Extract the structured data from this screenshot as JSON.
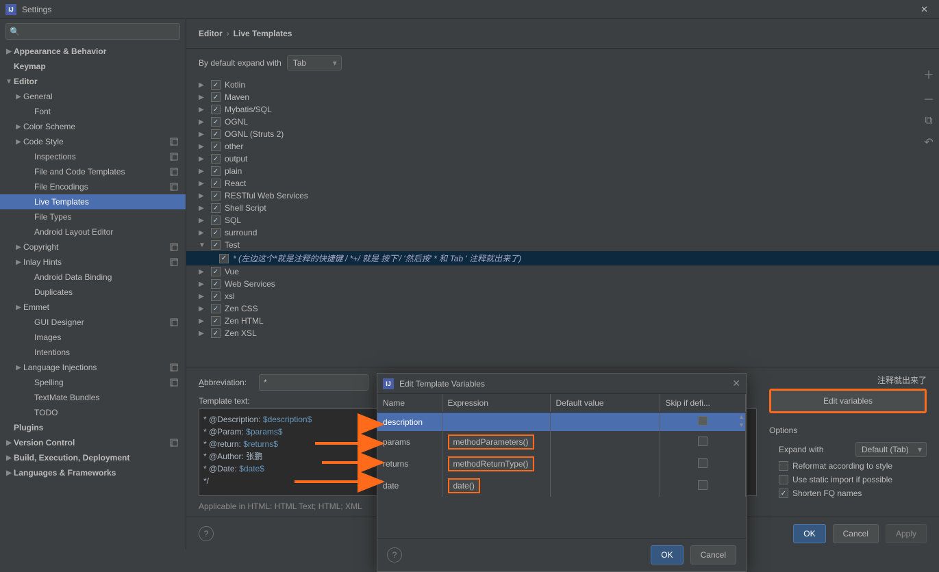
{
  "window": {
    "title": "Settings"
  },
  "search": {
    "placeholder": ""
  },
  "sidebar": {
    "items": [
      {
        "label": "Appearance & Behavior",
        "bold": true,
        "exp": "▶",
        "ind": 0
      },
      {
        "label": "Keymap",
        "bold": true,
        "exp": "",
        "ind": 0
      },
      {
        "label": "Editor",
        "bold": true,
        "exp": "▼",
        "ind": 0
      },
      {
        "label": "General",
        "exp": "▶",
        "ind": 1
      },
      {
        "label": "Font",
        "exp": "",
        "ind": 2
      },
      {
        "label": "Color Scheme",
        "exp": "▶",
        "ind": 1
      },
      {
        "label": "Code Style",
        "exp": "▶",
        "ind": 1,
        "badge": true
      },
      {
        "label": "Inspections",
        "exp": "",
        "ind": 2,
        "badge": true
      },
      {
        "label": "File and Code Templates",
        "exp": "",
        "ind": 2,
        "badge": true
      },
      {
        "label": "File Encodings",
        "exp": "",
        "ind": 2,
        "badge": true
      },
      {
        "label": "Live Templates",
        "exp": "",
        "ind": 2,
        "selected": true
      },
      {
        "label": "File Types",
        "exp": "",
        "ind": 2
      },
      {
        "label": "Android Layout Editor",
        "exp": "",
        "ind": 2
      },
      {
        "label": "Copyright",
        "exp": "▶",
        "ind": 1,
        "badge": true
      },
      {
        "label": "Inlay Hints",
        "exp": "▶",
        "ind": 1,
        "badge": true
      },
      {
        "label": "Android Data Binding",
        "exp": "",
        "ind": 2
      },
      {
        "label": "Duplicates",
        "exp": "",
        "ind": 2
      },
      {
        "label": "Emmet",
        "exp": "▶",
        "ind": 1
      },
      {
        "label": "GUI Designer",
        "exp": "",
        "ind": 2,
        "badge": true
      },
      {
        "label": "Images",
        "exp": "",
        "ind": 2
      },
      {
        "label": "Intentions",
        "exp": "",
        "ind": 2
      },
      {
        "label": "Language Injections",
        "exp": "▶",
        "ind": 1,
        "badge": true
      },
      {
        "label": "Spelling",
        "exp": "",
        "ind": 2,
        "badge": true
      },
      {
        "label": "TextMate Bundles",
        "exp": "",
        "ind": 2
      },
      {
        "label": "TODO",
        "exp": "",
        "ind": 2
      },
      {
        "label": "Plugins",
        "bold": true,
        "exp": "",
        "ind": 0
      },
      {
        "label": "Version Control",
        "bold": true,
        "exp": "▶",
        "ind": 0,
        "badge": true
      },
      {
        "label": "Build, Execution, Deployment",
        "bold": true,
        "exp": "▶",
        "ind": 0
      },
      {
        "label": "Languages & Frameworks",
        "bold": true,
        "exp": "▶",
        "ind": 0
      }
    ]
  },
  "breadcrumb": {
    "a": "Editor",
    "b": "Live Templates"
  },
  "expand": {
    "label": "By default expand with",
    "value": "Tab"
  },
  "templates": [
    {
      "label": "Kotlin",
      "exp": "▶",
      "chk": true
    },
    {
      "label": "Maven",
      "exp": "▶",
      "chk": true
    },
    {
      "label": "Mybatis/SQL",
      "exp": "▶",
      "chk": true
    },
    {
      "label": "OGNL",
      "exp": "▶",
      "chk": true
    },
    {
      "label": "OGNL (Struts 2)",
      "exp": "▶",
      "chk": true
    },
    {
      "label": "other",
      "exp": "▶",
      "chk": true
    },
    {
      "label": "output",
      "exp": "▶",
      "chk": true
    },
    {
      "label": "plain",
      "exp": "▶",
      "chk": true
    },
    {
      "label": "React",
      "exp": "▶",
      "chk": true
    },
    {
      "label": "RESTful Web Services",
      "exp": "▶",
      "chk": true
    },
    {
      "label": "Shell Script",
      "exp": "▶",
      "chk": true
    },
    {
      "label": "SQL",
      "exp": "▶",
      "chk": true
    },
    {
      "label": "surround",
      "exp": "▶",
      "chk": true
    },
    {
      "label": "Test",
      "exp": "▼",
      "chk": true
    },
    {
      "label": "* (左边这个*就是注释的快捷键  /  *+/ 就是 按下'/ '然后按' * 和 Tab ' 注释就出来了)",
      "child": true,
      "chk": true,
      "selected": true,
      "italic": true
    },
    {
      "label": "Vue",
      "exp": "▶",
      "chk": true
    },
    {
      "label": "Web Services",
      "exp": "▶",
      "chk": true
    },
    {
      "label": "xsl",
      "exp": "▶",
      "chk": true
    },
    {
      "label": "Zen CSS",
      "exp": "▶",
      "chk": true
    },
    {
      "label": "Zen HTML",
      "exp": "▶",
      "chk": true
    },
    {
      "label": "Zen XSL",
      "exp": "▶",
      "chk": true
    }
  ],
  "abbrev": {
    "label": "Abbreviation:",
    "value": "*",
    "desc_value": "注释就出来了"
  },
  "tmpltext": {
    "label": "Template text:",
    "lines": [
      {
        "pre": "* @Description: ",
        "var": "$description$"
      },
      {
        "pre": "* @Param: ",
        "var": "$params$"
      },
      {
        "pre": "* @return: ",
        "var": "$returns$"
      },
      {
        "pre": "* @Author: ",
        "txt": "张鹏"
      },
      {
        "pre": "* @Date: ",
        "var": "$date$"
      },
      {
        "pre": "*/"
      }
    ]
  },
  "applicable": "Applicable in HTML: HTML Text; HTML; XML",
  "editvar": "Edit variables",
  "options": {
    "title": "Options",
    "expand_label": "Expand with",
    "expand_value": "Default (Tab)",
    "o1": "Reformat according to style",
    "o2": "Use static import if possible",
    "o3": "Shorten FQ names"
  },
  "footer": {
    "ok": "OK",
    "cancel": "Cancel",
    "apply": "Apply"
  },
  "modal": {
    "title": "Edit Template Variables",
    "cols": {
      "name": "Name",
      "expr": "Expression",
      "def": "Default value",
      "skip": "Skip if defi..."
    },
    "rows": [
      {
        "name": "description",
        "expr": "",
        "skip": true,
        "sel": true
      },
      {
        "name": "params",
        "expr": "methodParameters()",
        "skip": false
      },
      {
        "name": "returns",
        "expr": "methodReturnType()",
        "skip": false
      },
      {
        "name": "date",
        "expr": "date()",
        "skip": false
      }
    ],
    "ok": "OK",
    "cancel": "Cancel"
  }
}
